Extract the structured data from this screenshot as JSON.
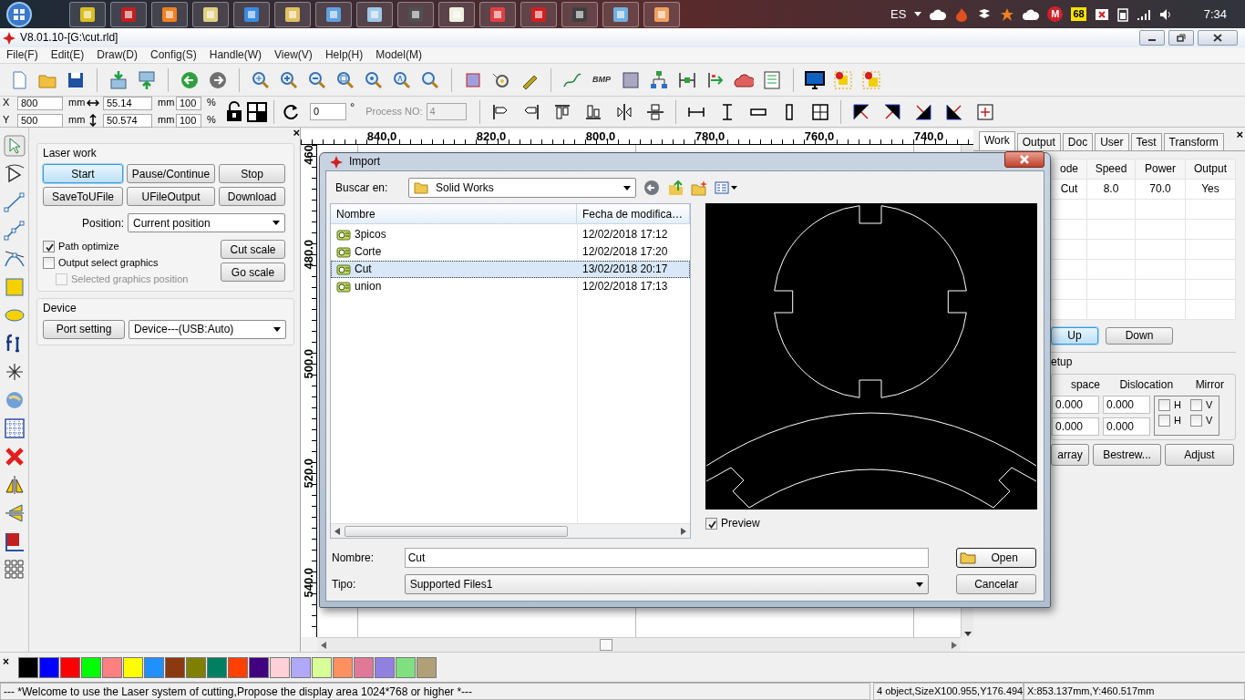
{
  "taskbar": {
    "language": "ES",
    "badge_m": "M",
    "badge_count": "68",
    "clock": "7:34"
  },
  "window": {
    "title": "V8.01.10-[G:\\cut.rld]"
  },
  "menu": [
    "File(F)",
    "Edit(E)",
    "Draw(D)",
    "Config(S)",
    "Handle(W)",
    "View(V)",
    "Help(H)",
    "Model(M)"
  ],
  "toolbar": {
    "bmp_label": "BMP"
  },
  "property_bar": {
    "position_fields": [
      {
        "label": "X",
        "value": "800",
        "unit": "mm"
      },
      {
        "label": "Y",
        "value": "500",
        "unit": "mm"
      }
    ],
    "size_fields": [
      {
        "value": "55.14",
        "unit": "mm"
      },
      {
        "value": "50.574",
        "unit": "mm"
      }
    ],
    "scale_fields": [
      {
        "value": "100",
        "unit": "%"
      },
      {
        "value": "100",
        "unit": "%"
      }
    ],
    "rotation": {
      "value": "0",
      "unit": "°"
    },
    "process_no": {
      "label": "Process NO:",
      "value": "4",
      "disabled": true
    }
  },
  "left_panel": {
    "close": "×",
    "laser_work": {
      "title": "Laser work",
      "buttons": [
        {
          "label": "Start",
          "focused": true
        },
        {
          "label": "Pause/Continue",
          "focused": false
        },
        {
          "label": "Stop",
          "focused": false
        },
        {
          "label": "SaveToUFile",
          "focused": false
        },
        {
          "label": "UFileOutput",
          "focused": false
        },
        {
          "label": "Download",
          "focused": false
        }
      ],
      "position_label": "Position:",
      "position_value": "Current position",
      "options": [
        {
          "label": "Path optimize",
          "checked": true,
          "disabled": false
        },
        {
          "label": "Output select graphics",
          "checked": false,
          "disabled": false
        },
        {
          "label": "Selected graphics position",
          "checked": false,
          "disabled": true
        }
      ],
      "scale_buttons": [
        "Cut scale",
        "Go scale"
      ]
    },
    "device": {
      "title": "Device",
      "port_button": "Port setting",
      "device_value": "Device---(USB:Auto)"
    }
  },
  "rulers": {
    "top_labels": [
      "840.0",
      "820.0",
      "800.0",
      "780.0",
      "760.0",
      "740.0"
    ],
    "left_labels": [
      "460",
      "480.0",
      "500.0",
      "520.0",
      "540.0"
    ]
  },
  "right_panel": {
    "close": "×",
    "tabs": [
      {
        "label": "Work",
        "selected": true
      },
      {
        "label": "Output",
        "selected": false
      },
      {
        "label": "Doc",
        "selected": false
      },
      {
        "label": "User",
        "selected": false
      },
      {
        "label": "Test",
        "selected": false
      },
      {
        "label": "Transform",
        "selected": false
      }
    ],
    "table": {
      "columns": [
        "ode",
        "Speed",
        "Power",
        "Output"
      ],
      "rows": [
        [
          "Cut",
          "8.0",
          "70.0",
          "Yes"
        ]
      ]
    },
    "move_buttons": [
      {
        "label": "Up",
        "focused": true
      },
      {
        "label": "Down",
        "focused": false
      }
    ],
    "array_setup": {
      "title": "etup",
      "columns": [
        "space",
        "Dislocation",
        "Mirror"
      ],
      "rows": [
        {
          "space": "0.000",
          "dislocation": "0.000",
          "mirror": [
            {
              "label": "H",
              "checked": false
            },
            {
              "label": "V",
              "checked": false
            }
          ]
        },
        {
          "space": "0.000",
          "dislocation": "0.000",
          "mirror": [
            {
              "label": "H",
              "checked": false
            },
            {
              "label": "V",
              "checked": false
            }
          ]
        }
      ]
    },
    "buttons": [
      "array",
      "Bestrew...",
      "Adjust"
    ]
  },
  "dialog": {
    "title": "Import",
    "look_in_label": "Buscar en:",
    "look_in_value": "Solid Works",
    "columns": [
      "Nombre",
      "Fecha de modifica…"
    ],
    "files": [
      {
        "name": "3picos",
        "date": "12/02/2018 17:12",
        "selected": false
      },
      {
        "name": "Corte",
        "date": "12/02/2018 17:20",
        "selected": false
      },
      {
        "name": "Cut",
        "date": "13/02/2018 20:17",
        "selected": true
      },
      {
        "name": "union",
        "date": "12/02/2018 17:13",
        "selected": false
      }
    ],
    "preview": {
      "label": "Preview",
      "checked": true
    },
    "filename_label": "Nombre:",
    "filename": "Cut",
    "type_label": "Tipo:",
    "type_value": "Supported Files1",
    "buttons": [
      {
        "label": "Open",
        "default": true
      },
      {
        "label": "Cancelar",
        "default": false
      }
    ]
  },
  "palette": {
    "close": "×",
    "colors": [
      {
        "color": "#000000"
      },
      {
        "color": "#0000ff"
      },
      {
        "color": "#ff0000"
      },
      {
        "color": "#00ff00"
      },
      {
        "color": "#ff8080"
      },
      {
        "color": "#ffff00"
      },
      {
        "color": "#2090ff"
      },
      {
        "color": "#8b3a10"
      },
      {
        "color": "#808000"
      },
      {
        "color": "#008060"
      },
      {
        "color": "#ff4000"
      },
      {
        "color": "#400080"
      },
      {
        "color": "#ffd0d8"
      },
      {
        "color": "#b0a8f8"
      },
      {
        "color": "#d8ff98"
      },
      {
        "color": "#ff9060"
      },
      {
        "color": "#e07898"
      },
      {
        "color": "#9080e0"
      },
      {
        "color": "#80e080"
      },
      {
        "color": "#b0a078"
      }
    ]
  },
  "status_bar": {
    "message": "--- *Welcome to use the Laser system of cutting,Propose the display area 1024*768 or higher *---",
    "selection": "4 object,SizeX100.955,Y176.494",
    "coordinates": "X:853.137mm,Y:460.517mm"
  }
}
